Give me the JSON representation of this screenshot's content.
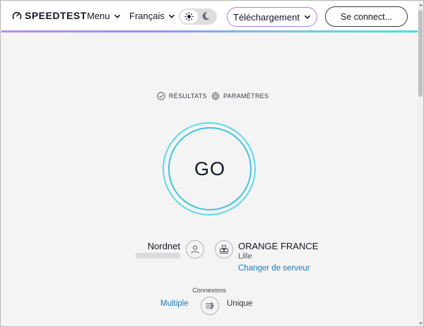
{
  "header": {
    "logo_text": "SPEEDTEST",
    "menu_label": "Menu",
    "language_label": "Français",
    "download_label": "Téléchargement",
    "login_label": "Se connect..."
  },
  "toolbar": {
    "results_label": "RÉSULTATS",
    "settings_label": "PARAMÈTRES"
  },
  "test": {
    "go_label": "GO"
  },
  "provider": {
    "isp_name": "Nordnet"
  },
  "server": {
    "name": "ORANGE FRANCE",
    "city": "Lille",
    "change_label": "Changer de serveur"
  },
  "connections": {
    "label": "Connexions",
    "multiple_label": "Multiple",
    "single_label": "Unique"
  },
  "colors": {
    "accent_link": "#1c7ab8",
    "go_ring": "#44c3da",
    "download_border": "#a97fef"
  },
  "icons": {
    "logo": "speedometer-icon",
    "theme_light": "sun-icon",
    "theme_dark": "moon-icon",
    "results": "check-circle-icon",
    "settings": "gear-icon",
    "isp": "user-icon",
    "server": "server-icon",
    "connections": "connections-icon"
  }
}
